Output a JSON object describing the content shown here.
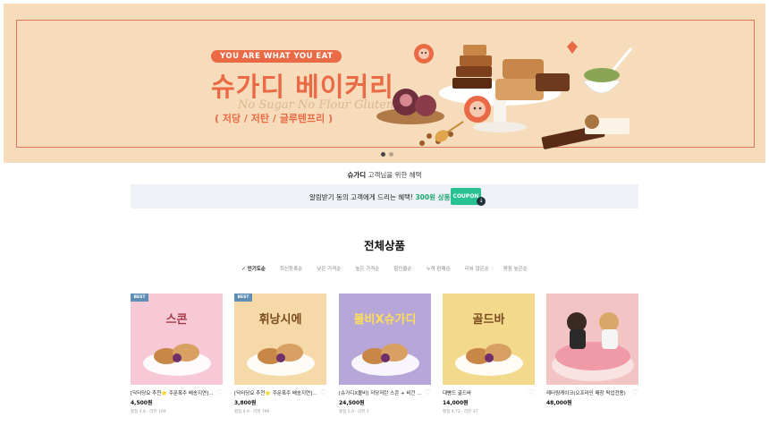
{
  "banner": {
    "tagline": "YOU ARE WHAT YOU EAT",
    "brand_title": "슈가디 베이커리",
    "script_text": "No Sugar No Flour Gluten Free",
    "subtitle": "( 저당 / 저탄 / 글루텐프리 )",
    "slide_count": 2,
    "active_slide": 1
  },
  "benefit": {
    "brand": "슈가디",
    "title_rest": "고객님을 위한 혜택",
    "coupon_text": "알림받기 동의 고객에게 드리는 혜택!",
    "coupon_highlight": "300원 상품중복할인",
    "coupon_button": "COUPON",
    "download_icon": "download-icon"
  },
  "section": {
    "title": "전체상품",
    "sort_tabs": [
      "인기도순",
      "최신등록순",
      "낮은 가격순",
      "높은 가격순",
      "할인율순",
      "누적 판매순",
      "리뷰 많은순",
      "평점 높은순"
    ],
    "active_sort": "인기도순"
  },
  "products": [
    {
      "badge": "BEST",
      "thumb_title": "스콘",
      "name": "[닥터당요 추천⭐ 주문폭주 배송지연] 스콘",
      "price": "4,500원",
      "review": "평점 4.8 · 리뷰 109",
      "bg": "#f7c8d5",
      "title_color": "#a33a4a"
    },
    {
      "badge": "BEST",
      "thumb_title": "휘낭시에",
      "name": "[닥터당요 추천⭐ 주문폭주 배송지연] 휘낭시에",
      "price": "3,800원",
      "review": "평점 4.9 · 리뷰 790",
      "bg": "#f5d9a8",
      "title_color": "#7a4a1e"
    },
    {
      "badge": "",
      "thumb_title": "볼비X슈가디",
      "name": "[슈가디X볼비] 저당저탄 스콘 + 비건 요거트",
      "price": "24,500원",
      "review": "평점 5.0 · 리뷰 2",
      "bg": "#b7a7d9",
      "title_color": "#ffde56"
    },
    {
      "badge": "",
      "thumb_title": "골드바",
      "name": "대빵드 골드바",
      "price": "14,000원",
      "review": "평점 4.72 · 리뷰 37",
      "bg": "#f3d98c",
      "title_color": "#7a4a1e"
    },
    {
      "badge": "",
      "thumb_title": "",
      "name": "레터링케이크(오프라인 매장 픽업전용)",
      "price": "48,000원",
      "review": "",
      "bg": "#f3c4c4",
      "title_color": "#ffffff"
    }
  ]
}
